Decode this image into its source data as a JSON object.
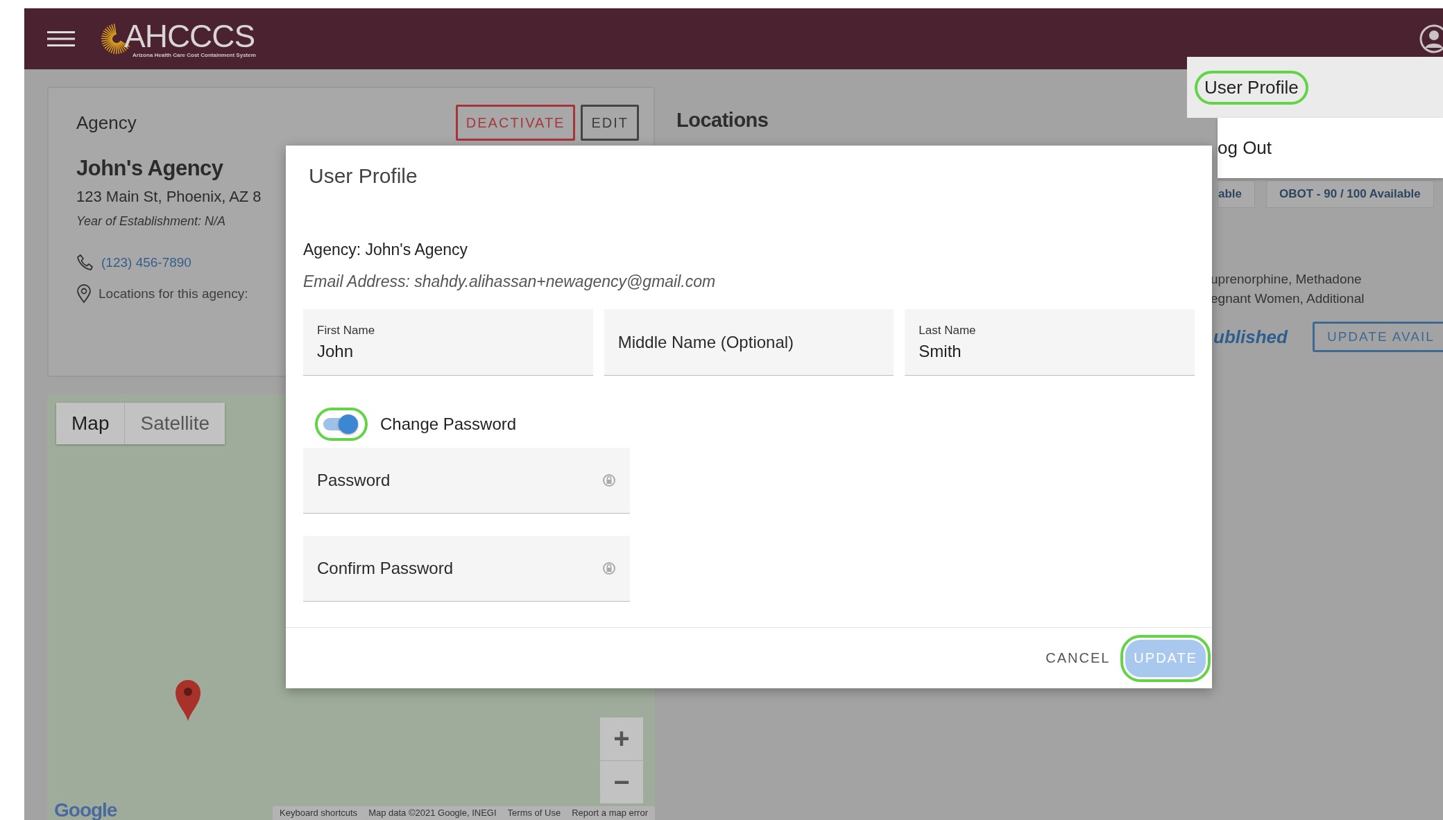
{
  "header": {
    "logo_text": "AHCCCS",
    "logo_subtitle": "Arizona Health Care Cost Containment System"
  },
  "agency_card": {
    "title": "Agency",
    "buttons": [
      {
        "label": "DEACTIVATE",
        "kind": "danger"
      },
      {
        "label": "EDIT",
        "kind": "outline"
      }
    ],
    "name": "John's Agency",
    "address": "123 Main St, Phoenix, AZ 8",
    "established": "Year of Establishment: N/A",
    "phone": "(123) 456-7890",
    "locations_label": "Locations for this agency:"
  },
  "map": {
    "tabs": [
      {
        "label": "Map",
        "selected": true
      },
      {
        "label": "Satellite",
        "selected": false
      }
    ],
    "zoom_buttons": [
      "+",
      "−"
    ],
    "logo": "Google",
    "footer_links": [
      "Keyboard shortcuts",
      "Map data ©2021 Google, INEGI",
      "Terms of Use",
      "Report a map error"
    ]
  },
  "locations": {
    "title": "Locations",
    "chips": [
      "able",
      "OBOT - 90 / 100 Available"
    ],
    "details": [
      "uprenorphine, Methadone",
      "egnant Women, Additional"
    ],
    "status": "ublished",
    "button": "UPDATE AVAIL"
  },
  "user_menu": {
    "items": [
      {
        "label": "User Profile",
        "selected": true,
        "highlighted": true
      },
      {
        "label": "og Out",
        "selected": false,
        "highlighted": false
      }
    ]
  },
  "dialog": {
    "title": "User Profile",
    "agency": "Agency: John's Agency",
    "email": "Email Address: shahdy.alihassan+newagency@gmail.com",
    "name_fields": [
      {
        "label": "First Name",
        "value": "John"
      },
      {
        "placeholder": "Middle Name (Optional)"
      },
      {
        "label": "Last Name",
        "value": "Smith"
      }
    ],
    "change_password": {
      "label": "Change Password",
      "on": true,
      "highlighted": true
    },
    "password_fields": [
      {
        "placeholder": "Password"
      },
      {
        "placeholder": "Confirm Password"
      }
    ],
    "buttons": [
      {
        "label": "CANCEL",
        "kind": "text",
        "disabled": false,
        "highlighted": false
      },
      {
        "label": "UPDATE",
        "kind": "primary",
        "disabled": true,
        "highlighted": true
      }
    ]
  }
}
